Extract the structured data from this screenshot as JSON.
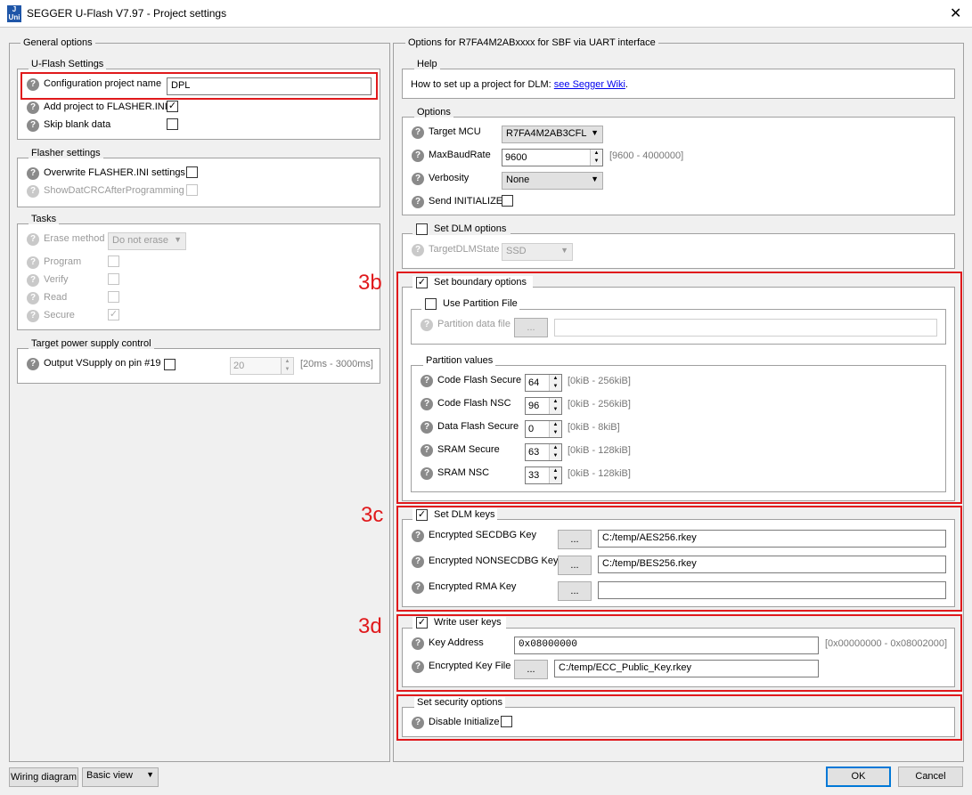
{
  "window": {
    "title": "SEGGER U-Flash V7.97 - Project settings",
    "icon_text": "J\nUni"
  },
  "annotations": {
    "a3b": "3b",
    "a3c": "3c",
    "a3d": "3d"
  },
  "general": {
    "title": "General options",
    "uflash": {
      "title": "U-Flash Settings",
      "config_name_label": "Configuration project name",
      "config_name_value": "DPL",
      "add_project_label": "Add project to FLASHER.INI",
      "add_project_checked": true,
      "skip_blank_label": "Skip blank data",
      "skip_blank_checked": false
    },
    "flasher": {
      "title": "Flasher settings",
      "overwrite_label": "Overwrite FLASHER.INI settings",
      "showdat_label": "ShowDatCRCAfterProgramming"
    },
    "tasks": {
      "title": "Tasks",
      "erase_label": "Erase method",
      "erase_value": "Do not erase",
      "program_label": "Program",
      "verify_label": "Verify",
      "read_label": "Read",
      "secure_label": "Secure",
      "secure_checked": true
    },
    "power": {
      "title": "Target power supply control",
      "output_label": "Output VSupply on pin #19",
      "spin_value": "20",
      "range": "[20ms - 3000ms]"
    }
  },
  "options": {
    "title": "Options for R7FA4M2ABxxxx for SBF via UART interface",
    "help": {
      "title": "Help",
      "text": "How to set up a project for DLM: ",
      "link_text": "see Segger Wiki",
      "trailing": "."
    },
    "opts": {
      "title": "Options",
      "target_mcu_label": "Target MCU",
      "target_mcu_value": "R7FA4M2AB3CFL",
      "baud_label": "MaxBaudRate",
      "baud_value": "9600",
      "baud_range": "[9600 - 4000000]",
      "verbosity_label": "Verbosity",
      "verbosity_value": "None",
      "send_init_label": "Send INITIALIZE"
    },
    "dlm": {
      "title": "Set DLM options",
      "target_state_label": "TargetDLMState",
      "target_state_value": "SSD"
    },
    "boundary": {
      "title": "Set boundary options",
      "checked": true,
      "use_partition_label": "Use Partition File",
      "partition_file_label": "Partition data file",
      "browse_label": "...",
      "values_title": "Partition values",
      "rows": [
        {
          "label": "Code Flash Secure",
          "value": "64",
          "range": "[0kiB - 256kiB]"
        },
        {
          "label": "Code Flash NSC",
          "value": "96",
          "range": "[0kiB - 256kiB]"
        },
        {
          "label": "Data Flash Secure",
          "value": "0",
          "range": "[0kiB - 8kiB]"
        },
        {
          "label": "SRAM Secure",
          "value": "63",
          "range": "[0kiB - 128kiB]"
        },
        {
          "label": "SRAM NSC",
          "value": "33",
          "range": "[0kiB - 128kiB]"
        }
      ]
    },
    "dlmkeys": {
      "title": "Set DLM keys",
      "checked": true,
      "browse_label": "...",
      "rows": [
        {
          "label": "Encrypted SECDBG Key",
          "value": "C:/temp/AES256.rkey"
        },
        {
          "label": "Encrypted NONSECDBG Key",
          "value": "C:/temp/BES256.rkey"
        },
        {
          "label": "Encrypted RMA Key",
          "value": ""
        }
      ]
    },
    "userkeys": {
      "title": "Write user keys",
      "checked": true,
      "key_address_label": "Key Address",
      "key_address_value": "0x08000000",
      "key_address_range": "[0x00000000 - 0x08002000]",
      "encrypted_file_label": "Encrypted Key File",
      "browse_label": "...",
      "encrypted_file_value": "C:/temp/ECC_Public_Key.rkey"
    },
    "security": {
      "title": "Set security options",
      "disable_init_label": "Disable Initialize"
    }
  },
  "footer": {
    "wiring_label": "Wiring diagram",
    "view_value": "Basic view",
    "ok_label": "OK",
    "cancel_label": "Cancel"
  },
  "icons": {
    "help": "help-icon",
    "dropdown": "chevron-down-icon",
    "check": "checkmark-icon",
    "close": "close-icon"
  },
  "colors": {
    "highlight": "#e0191c",
    "link": "#0000ee",
    "default_button": "#0078d7"
  }
}
